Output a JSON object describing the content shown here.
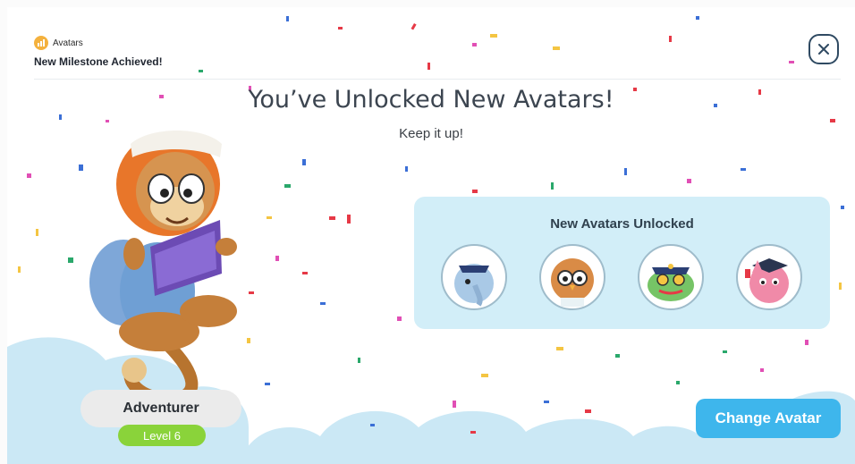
{
  "header": {
    "breadcrumb_icon": "chart-bars-icon",
    "breadcrumb_label": "Avatars",
    "subtitle": "New Milestone Achieved!",
    "close_icon": "close-icon"
  },
  "hero": {
    "title": "You’ve Unlocked New Avatars!",
    "tagline": "Keep it up!"
  },
  "unlocked": {
    "title": "New Avatars Unlocked",
    "avatars": [
      {
        "name": "elephant-police-avatar",
        "color": "#a9c9e6"
      },
      {
        "name": "owl-doctor-avatar",
        "color": "#d98b46"
      },
      {
        "name": "frog-police-avatar",
        "color": "#76c466"
      },
      {
        "name": "cat-graduate-avatar",
        "color": "#f08aa8"
      }
    ]
  },
  "profile": {
    "avatar_name": "Adventurer",
    "level": "Level 6"
  },
  "actions": {
    "change_avatar": "Change Avatar"
  },
  "colors": {
    "accent_blue": "#3eb6ec",
    "level_green": "#8ad33a",
    "panel_bg": "#d2eef8",
    "cloud": "#c9e7f4"
  }
}
